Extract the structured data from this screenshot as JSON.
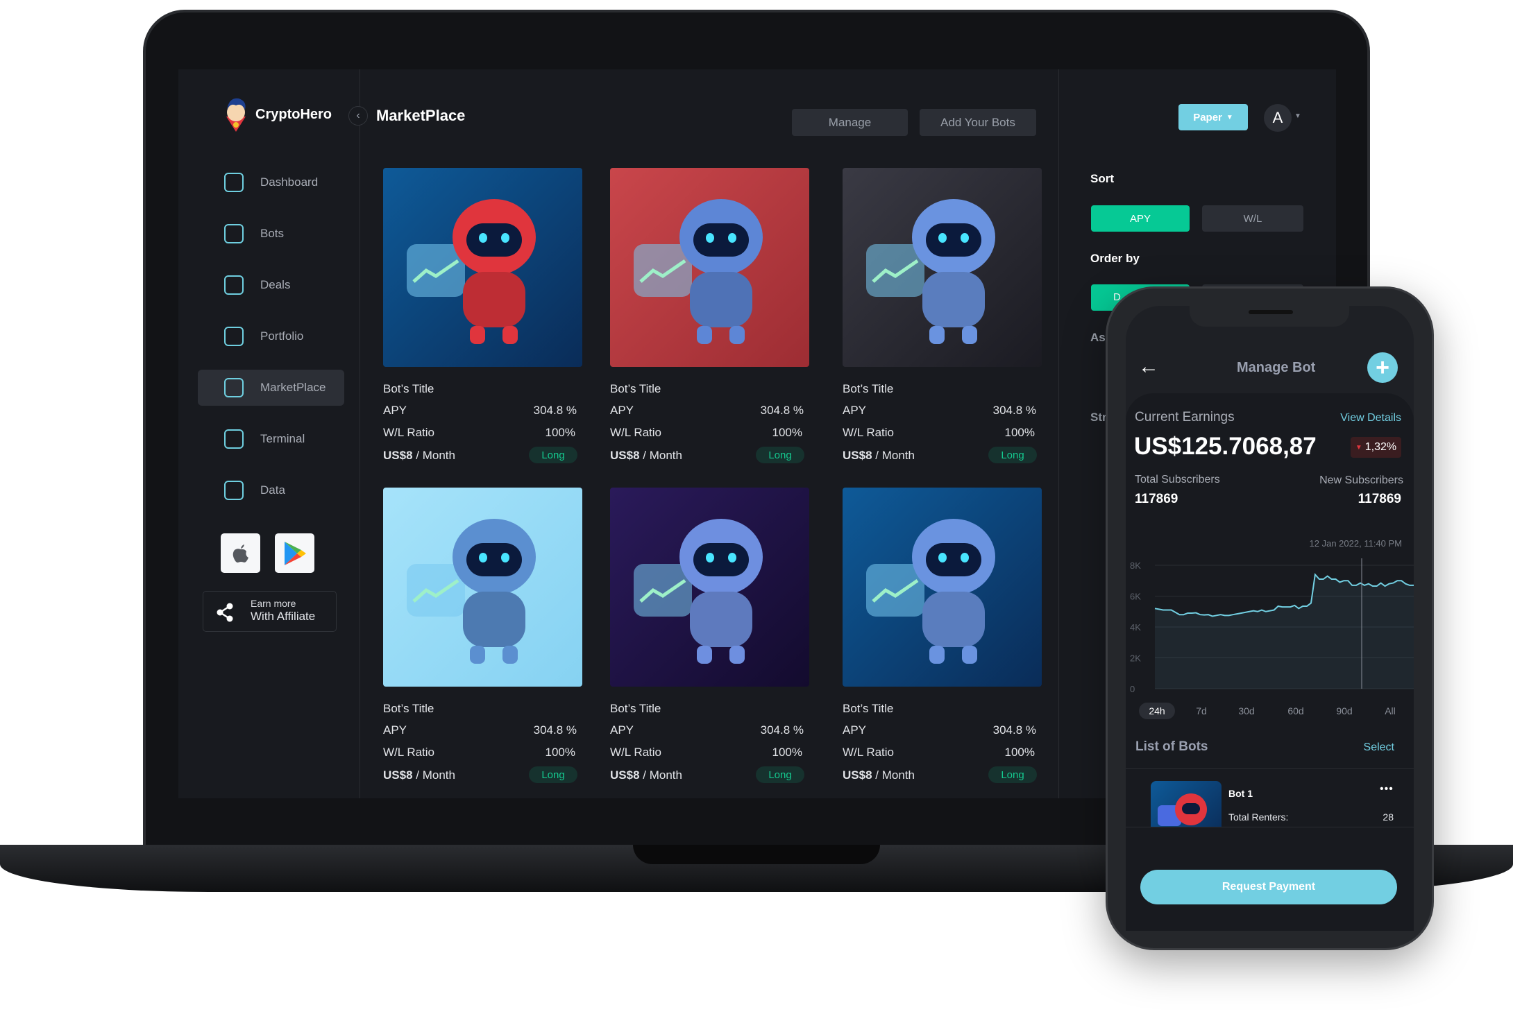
{
  "app": {
    "name": "CryptoHero",
    "page_title": "MarketPlace"
  },
  "sidebar": {
    "items": [
      {
        "label": "Dashboard",
        "icon": "dashboard-icon"
      },
      {
        "label": "Bots",
        "icon": "bot-icon"
      },
      {
        "label": "Deals",
        "icon": "deals-icon"
      },
      {
        "label": "Portfolio",
        "icon": "portfolio-icon"
      },
      {
        "label": "MarketPlace",
        "icon": "marketplace-icon",
        "active": true
      },
      {
        "label": "Terminal",
        "icon": "terminal-icon"
      },
      {
        "label": "Data",
        "icon": "data-layers-icon"
      }
    ],
    "affiliate": {
      "line1": "Earn more",
      "line2": "With Affiliate"
    }
  },
  "header": {
    "manage": "Manage",
    "add_bots": "Add Your Bots",
    "account_mode": "Paper",
    "avatar": "A"
  },
  "filters": {
    "sort_label": "Sort",
    "sort_options": [
      "APY",
      "W/L"
    ],
    "sort_selected": "APY",
    "order_label": "Order by",
    "order_partial": "D",
    "asset_partial": "As",
    "strategy_partial": "Str"
  },
  "labels": {
    "apy": "APY",
    "wl": "W/L Ratio",
    "per": "/ Month"
  },
  "cards": [
    {
      "title": "Bot’s Title",
      "apy": "304.8 %",
      "wl": "100%",
      "price": "US$8",
      "tag": "Long",
      "bg": [
        "#0e5a98",
        "#0a2c58"
      ],
      "robot": "#e0353d"
    },
    {
      "title": "Bot’s Title",
      "apy": "304.8 %",
      "wl": "100%",
      "price": "US$8",
      "tag": "Long",
      "bg": [
        "#c9464b",
        "#9d2d33"
      ],
      "robot": "#5d86d6"
    },
    {
      "title": "Bot’s Title",
      "apy": "304.8 %",
      "wl": "100%",
      "price": "US$8",
      "tag": "Long",
      "bg": [
        "#3a3a44",
        "#1b1b22"
      ],
      "robot": "#6a93e0"
    },
    {
      "title": "Bot’s Title",
      "apy": "304.8 %",
      "wl": "100%",
      "price": "US$8",
      "tag": "Long",
      "bg": [
        "#a6e3fa",
        "#86d2f2"
      ],
      "robot": "#5b8fd0"
    },
    {
      "title": "Bot’s Title",
      "apy": "304.8 %",
      "wl": "100%",
      "price": "US$8",
      "tag": "Long",
      "bg": [
        "#2a1a5a",
        "#130b2e"
      ],
      "robot": "#6e8fe0"
    },
    {
      "title": "Bot’s Title",
      "apy": "304.8 %",
      "wl": "100%",
      "price": "US$8",
      "tag": "Long",
      "bg": [
        "#0e5a98",
        "#0a2c58"
      ],
      "robot": "#6a93e0"
    }
  ],
  "phone": {
    "title": "Manage Bot",
    "earnings_label": "Current Earnings",
    "view_details": "View Details",
    "earnings": "US$125.7068,87",
    "change": "1,32%",
    "change_direction": "down",
    "total_subs_label": "Total Subscribers",
    "total_subs": "117869",
    "new_subs_label": "New Subscribers",
    "new_subs": "117869",
    "tooltip_date": "12 Jan 2022, 11:40 PM",
    "timeframes": [
      "24h",
      "7d",
      "30d",
      "60d",
      "90d",
      "All"
    ],
    "timeframe_selected": "24h",
    "list_title": "List of Bots",
    "select": "Select",
    "bot": {
      "name": "Bot 1",
      "renters_label": "Total Renters:",
      "renters": "28"
    },
    "request_payment": "Request Payment"
  },
  "colors": {
    "accent": "#72cfe2",
    "green": "#06c995",
    "red": "#e0353d"
  },
  "chart_data": {
    "type": "area",
    "yticks": [
      "0",
      "2K",
      "4K",
      "6K",
      "8K"
    ],
    "ylim": [
      0,
      8000
    ],
    "grid": true,
    "values": [
      5200,
      5150,
      5100,
      5100,
      5100,
      4950,
      4800,
      4800,
      4900,
      4900,
      4920,
      4800,
      4780,
      4800,
      4700,
      4750,
      4800,
      4750,
      4750,
      4800,
      4850,
      4900,
      4950,
      5000,
      5050,
      5000,
      5100,
      5000,
      5050,
      5100,
      5350,
      5300,
      5300,
      5300,
      5400,
      5200,
      5350,
      5350,
      5550,
      7400,
      7100,
      7100,
      7300,
      7100,
      7100,
      6900,
      7000,
      7000,
      6700,
      6700,
      6850,
      6700,
      6800,
      6650,
      6650,
      6850,
      6650,
      6800,
      6850,
      7000,
      7000,
      6800,
      6700,
      6700
    ]
  }
}
